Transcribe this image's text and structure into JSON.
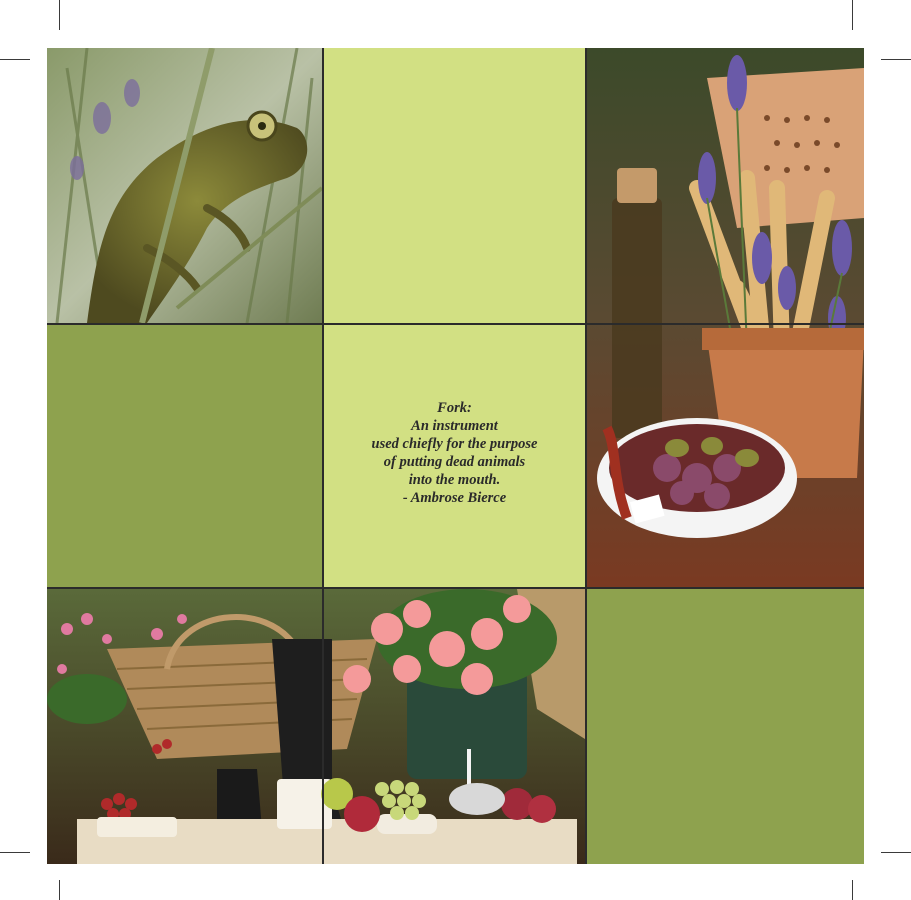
{
  "quote": {
    "lines": [
      "Fork:",
      "An instrument",
      "used chiefly for the purpose",
      "of putting dead animals",
      "into the mouth.",
      "- Ambrose Bierce"
    ]
  },
  "colors": {
    "light_panel": "#d2e083",
    "olive_panel": "#8ea24e",
    "grid_lines": "#2b2b2b"
  },
  "photos": {
    "top_left": "chameleon-on-lavender-photo",
    "right_column": "lavender-breadsticks-olives-photo",
    "bottom": "garden-market-table-photo"
  }
}
